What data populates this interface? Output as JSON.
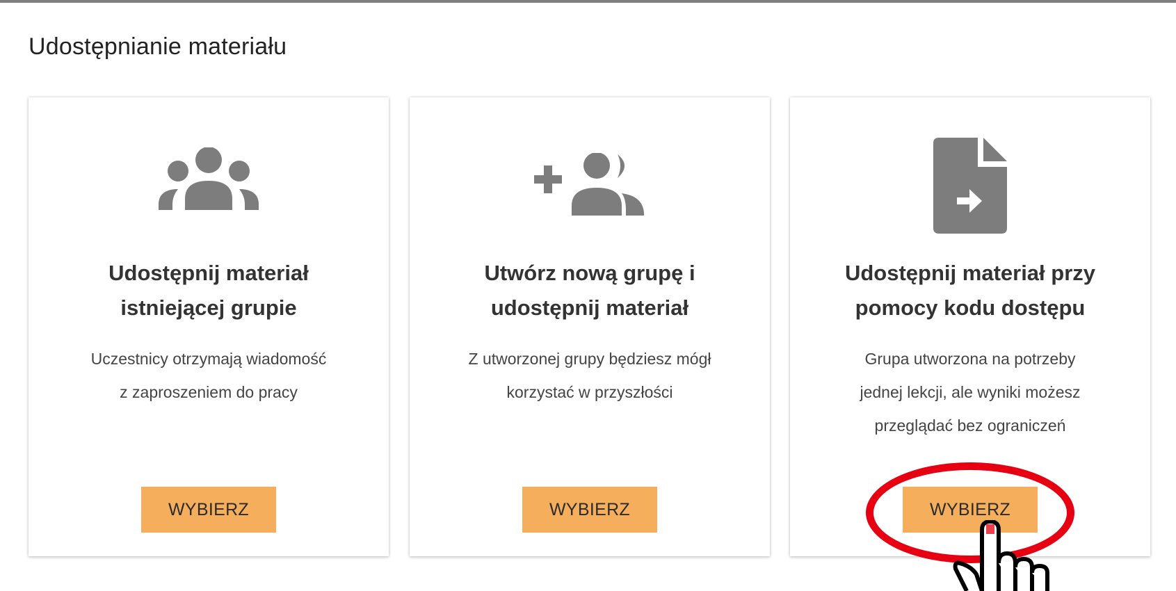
{
  "page": {
    "title": "Udostępnianie materiału"
  },
  "cards": [
    {
      "icon": "users-group-icon",
      "title_line1": "Udostępnij materiał",
      "title_line2": "istniejącej grupie",
      "desc_line1": "Uczestnicy otrzymają wiadomość",
      "desc_line2": "z zaproszeniem do pracy",
      "desc_line3": "",
      "button_label": "WYBIERZ"
    },
    {
      "icon": "add-users-icon",
      "title_line1": "Utwórz nową grupę i",
      "title_line2": "udostępnij materiał",
      "desc_line1": "Z utworzonej grupy będziesz mógł",
      "desc_line2": "korzystać w przyszłości",
      "desc_line3": "",
      "button_label": "WYBIERZ"
    },
    {
      "icon": "file-export-icon",
      "title_line1": "Udostępnij materiał przy",
      "title_line2": "pomocy kodu dostępu",
      "desc_line1": "Grupa utworzona na potrzeby",
      "desc_line2": "jednej lekcji, ale wyniki możesz",
      "desc_line3": "przeglądać bez ograniczeń",
      "button_label": "WYBIERZ"
    }
  ],
  "annotation": {
    "highlight_color": "#e60012",
    "pointer": "hand-pointer-icon"
  },
  "colors": {
    "button_bg": "#f5ae5b",
    "icon_gray": "#7d7d7d",
    "top_border": "#7f7f7f"
  }
}
